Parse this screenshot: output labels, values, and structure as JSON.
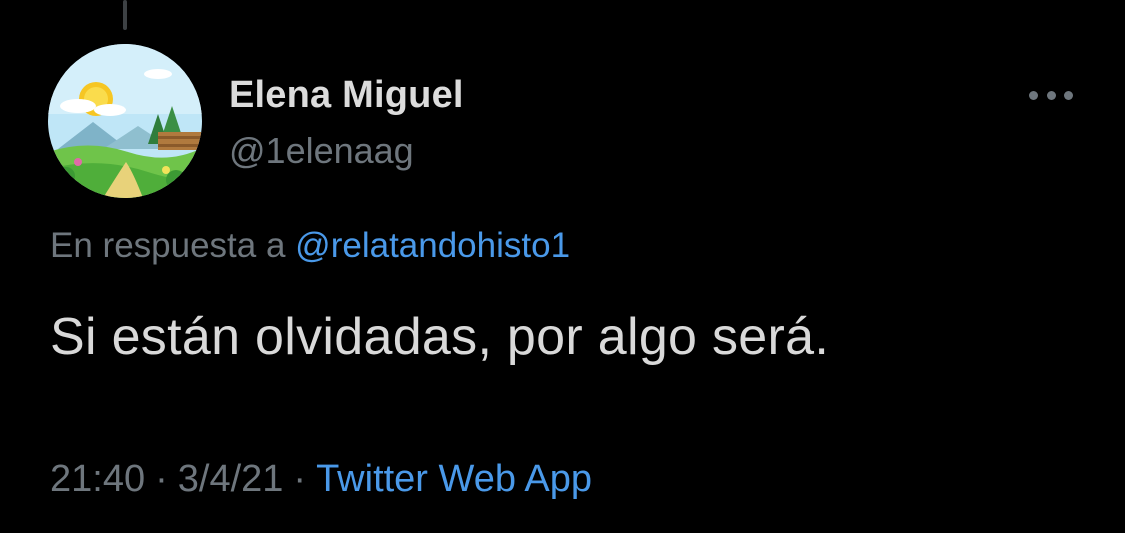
{
  "tweet": {
    "display_name": "Elena Miguel",
    "username": "@1elenaag",
    "reply_prefix": "En respuesta a",
    "reply_to": "@relatandohisto1",
    "text": "Si están olvidadas, por algo será.",
    "time": "21:40",
    "separator": "·",
    "date": "3/4/21",
    "source": "Twitter Web App"
  },
  "icons": {
    "avatar": "avatar-landscape-image",
    "more": "more-options-icon"
  },
  "colors": {
    "background": "#000000",
    "text_primary": "#d9d9d9",
    "text_secondary": "#6e767d",
    "link": "#4a99e9"
  }
}
